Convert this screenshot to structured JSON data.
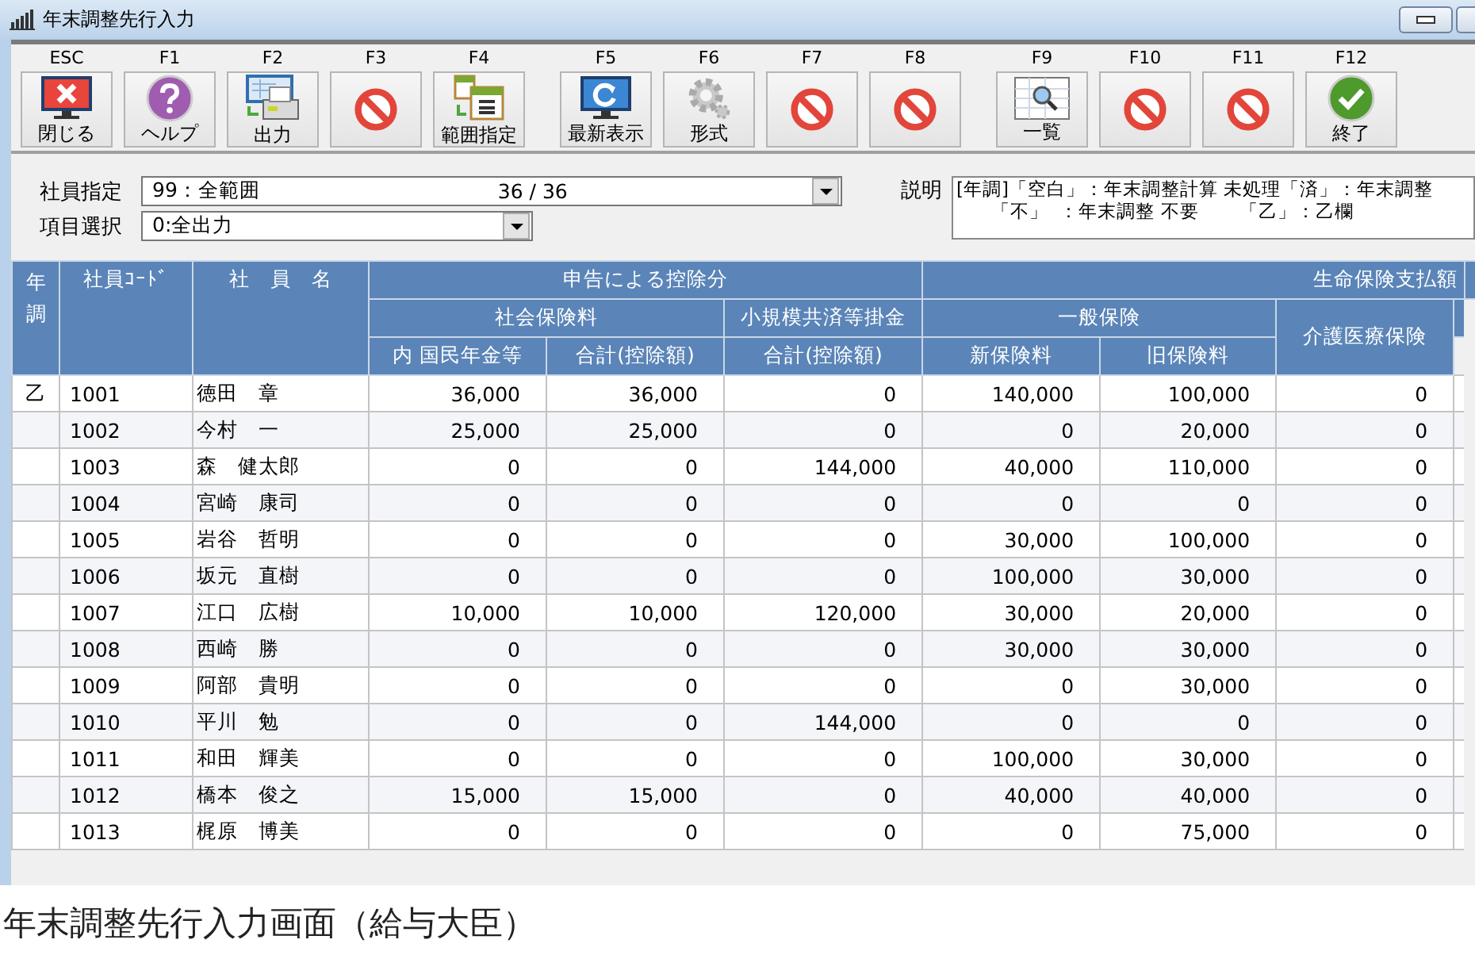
{
  "window": {
    "title": "年末調整先行入力"
  },
  "toolbar": {
    "buttons": [
      {
        "key": "ESC",
        "label": "閉じる",
        "kind": "close"
      },
      {
        "key": "F1",
        "label": "ヘルプ",
        "kind": "help"
      },
      {
        "key": "F2",
        "label": "出力",
        "kind": "output"
      },
      {
        "key": "F3",
        "kind": "disabled"
      },
      {
        "key": "F4",
        "label": "範囲指定",
        "kind": "range"
      },
      {
        "key": "F5",
        "label": "最新表示",
        "kind": "refresh"
      },
      {
        "key": "F6",
        "label": "形式",
        "kind": "gear"
      },
      {
        "key": "F7",
        "kind": "disabled"
      },
      {
        "key": "F8",
        "kind": "disabled"
      },
      {
        "key": "F9",
        "label": "一覧",
        "kind": "list"
      },
      {
        "key": "F10",
        "kind": "disabled"
      },
      {
        "key": "F11",
        "kind": "disabled"
      },
      {
        "key": "F12",
        "label": "終了",
        "kind": "exit"
      }
    ]
  },
  "form": {
    "employee": {
      "label": "社員指定",
      "value": "99：全範囲",
      "count": "36 / 36"
    },
    "item": {
      "label": "項目選択",
      "value": "0:全出力"
    },
    "description": {
      "label": "説明",
      "lines": [
        "[年調]「空白」：年末調整計算 未処理「済」：年末調整",
        "      「不」  ：年末調整 不要       「乙」：乙欄"
      ]
    }
  },
  "table": {
    "header_rows": [
      [
        {
          "text": "年調",
          "rowspan": 3
        },
        {
          "text": "社員ｺｰﾄﾞ",
          "rowspan": 3
        },
        {
          "text": "社　員　名",
          "rowspan": 3
        },
        {
          "text": "申告による控除分",
          "colspan": 3
        },
        {
          "text": "生命保険支払額",
          "colspan": 4
        }
      ],
      [
        {
          "text": "社会保険料",
          "colspan": 2
        },
        {
          "text": "小規模共済等掛金"
        },
        {
          "text": "一般保険",
          "colspan": 2
        },
        {
          "text": "介護医療保険",
          "rowspan": 2
        }
      ],
      [
        {
          "text": "内 国民年金等"
        },
        {
          "text": "合計(控除額)"
        },
        {
          "text": "合計(控除額)"
        },
        {
          "text": "新保険料"
        },
        {
          "text": "旧保険料"
        }
      ]
    ],
    "rows": [
      {
        "adjust": "乙",
        "code": "1001",
        "name": "徳田　章",
        "values": [
          "36,000",
          "36,000",
          "0",
          "140,000",
          "100,000",
          "0"
        ]
      },
      {
        "code": "1002",
        "name": "今村　一",
        "values": [
          "25,000",
          "25,000",
          "0",
          "0",
          "20,000",
          "0"
        ]
      },
      {
        "code": "1003",
        "name": "森　健太郎",
        "values": [
          "0",
          "0",
          "144,000",
          "40,000",
          "110,000",
          "0"
        ]
      },
      {
        "code": "1004",
        "name": "宮崎　康司",
        "values": [
          "0",
          "0",
          "0",
          "0",
          "0",
          "0"
        ]
      },
      {
        "code": "1005",
        "name": "岩谷　哲明",
        "values": [
          "0",
          "0",
          "0",
          "30,000",
          "100,000",
          "0"
        ]
      },
      {
        "code": "1006",
        "name": "坂元　直樹",
        "values": [
          "0",
          "0",
          "0",
          "100,000",
          "30,000",
          "0"
        ]
      },
      {
        "code": "1007",
        "name": "江口　広樹",
        "values": [
          "10,000",
          "10,000",
          "120,000",
          "30,000",
          "20,000",
          "0"
        ]
      },
      {
        "code": "1008",
        "name": "西崎　勝",
        "values": [
          "0",
          "0",
          "0",
          "30,000",
          "30,000",
          "0"
        ]
      },
      {
        "code": "1009",
        "name": "阿部　貴明",
        "values": [
          "0",
          "0",
          "0",
          "0",
          "30,000",
          "0"
        ]
      },
      {
        "code": "1010",
        "name": "平川　勉",
        "values": [
          "0",
          "0",
          "144,000",
          "0",
          "0",
          "0"
        ]
      },
      {
        "code": "1011",
        "name": "和田　輝美",
        "values": [
          "0",
          "0",
          "0",
          "100,000",
          "30,000",
          "0"
        ]
      },
      {
        "code": "1012",
        "name": "橋本　俊之",
        "values": [
          "15,000",
          "15,000",
          "0",
          "40,000",
          "40,000",
          "0"
        ]
      },
      {
        "code": "1013",
        "name": "梶原　博美",
        "values": [
          "0",
          "0",
          "0",
          "0",
          "75,000",
          "0"
        ]
      }
    ]
  },
  "caption": "年末調整先行入力画面（給与大臣）"
}
